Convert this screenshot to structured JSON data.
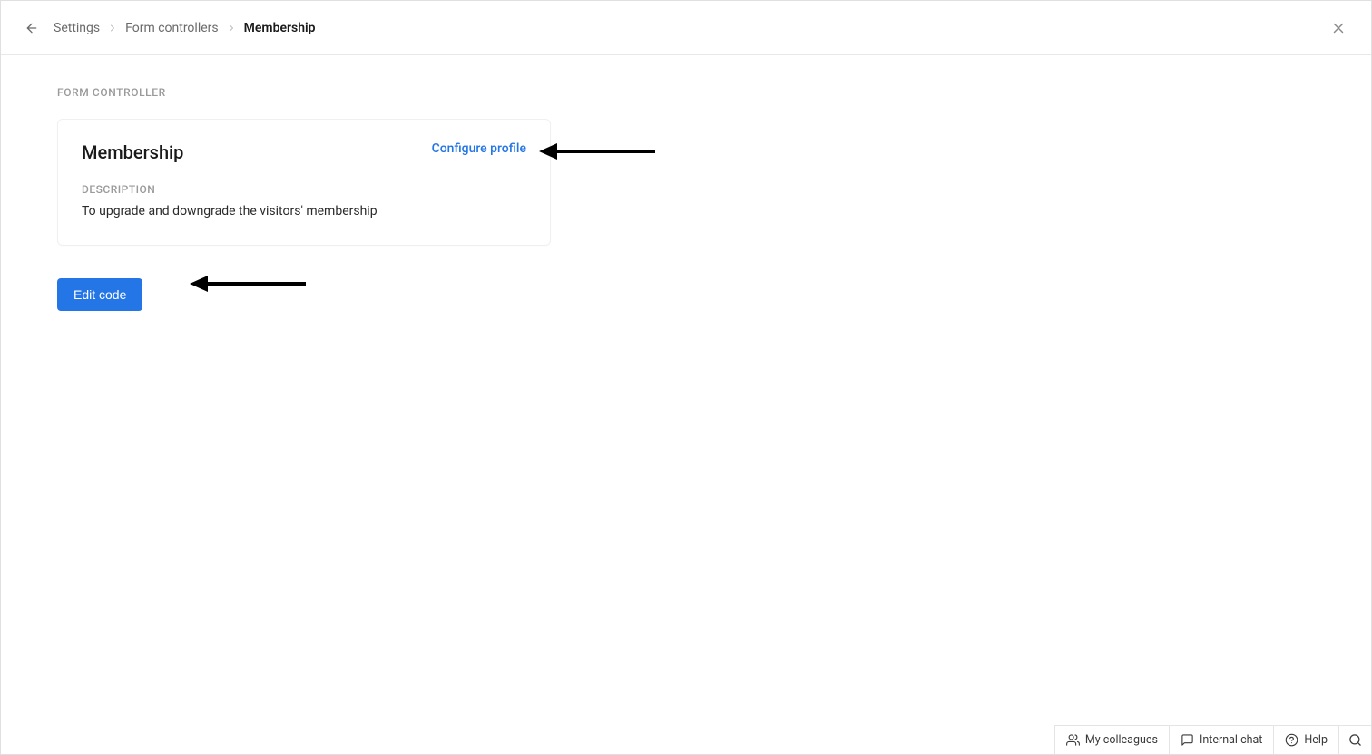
{
  "breadcrumb": {
    "items": [
      "Settings",
      "Form controllers"
    ],
    "current": "Membership"
  },
  "section_label": "FORM CONTROLLER",
  "card": {
    "title": "Membership",
    "configure_link": "Configure profile",
    "description_label": "DESCRIPTION",
    "description_text": "To upgrade and downgrade the visitors' membership"
  },
  "edit_code_button": "Edit code",
  "footer": {
    "colleagues": "My colleagues",
    "internal_chat": "Internal chat",
    "help": "Help"
  }
}
